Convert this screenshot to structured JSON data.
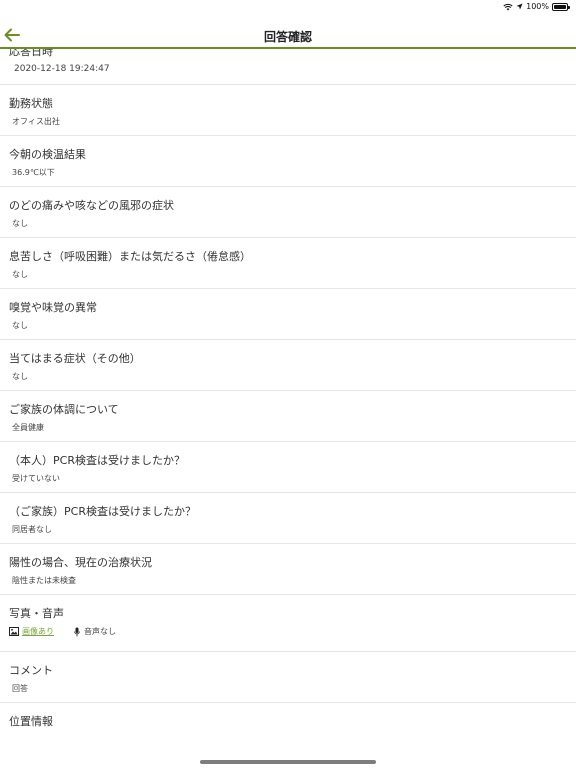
{
  "status_bar": {
    "battery_text": "100%"
  },
  "nav": {
    "title": "回答確認"
  },
  "items": [
    {
      "label": "応答日時",
      "value": "2020-12-18 19:24:47"
    },
    {
      "label": "勤務状態",
      "value": "オフィス出社"
    },
    {
      "label": "今朝の検温結果",
      "value": "36.9℃以下"
    },
    {
      "label": "のどの痛みや咳などの風邪の症状",
      "value": "なし"
    },
    {
      "label": "息苦しさ（呼吸困難）または気だるさ（倦怠感）",
      "value": "なし"
    },
    {
      "label": "嗅覚や味覚の異常",
      "value": "なし"
    },
    {
      "label": "当てはまる症状（その他）",
      "value": "なし"
    },
    {
      "label": "ご家族の体調について",
      "value": "全員健康"
    },
    {
      "label": "（本人）PCR検査は受けましたか？",
      "value": "受けていない"
    },
    {
      "label": "（ご家族）PCR検査は受けましたか？",
      "value": "同居者なし"
    },
    {
      "label": "陽性の場合、現在の治療状況",
      "value": "陰性または未検査"
    }
  ],
  "media": {
    "label": "写真・音声",
    "image_link": "画像あり",
    "audio_text": "音声なし"
  },
  "comment": {
    "label": "コメント",
    "value": "回答"
  },
  "location": {
    "label": "位置情報"
  },
  "colors": {
    "accent": "#6b8e23",
    "link": "#7aa53a"
  }
}
